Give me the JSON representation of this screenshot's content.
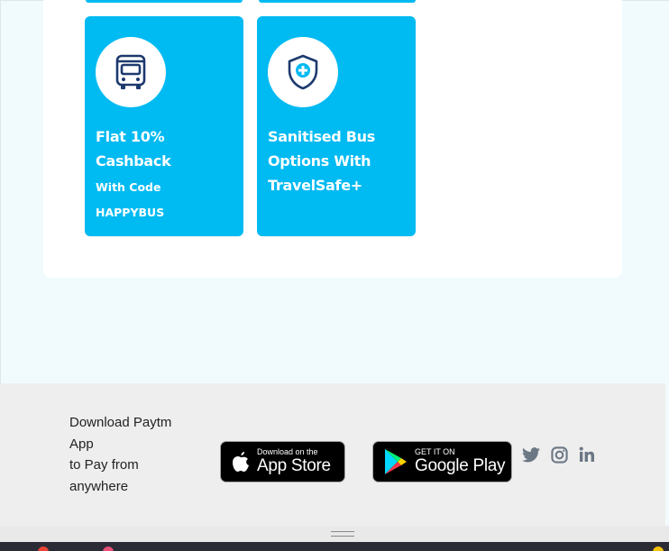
{
  "offers": [
    {
      "icon": "bus-icon",
      "title": "Flat 10% Cashback",
      "title_line1": "Flat 10%",
      "title_line2": "Cashback",
      "subtitle_line1": "With Code",
      "subtitle_line2": "HAPPYBUS"
    },
    {
      "icon": "shield-plus-icon",
      "title_line1": "Sanitised Bus",
      "title_line2": "Options With",
      "title_line3": "TravelSafe+"
    }
  ],
  "footer": {
    "download_line1": "Download Paytm",
    "download_line2": "App",
    "download_line3": "to Pay from",
    "download_line4": "anywhere",
    "app_store": {
      "small": "Download on the",
      "big": "App Store"
    },
    "google_play": {
      "small": "GET IT ON",
      "big": "Google Play"
    },
    "social": [
      "twitter-icon",
      "instagram-icon",
      "linkedin-icon"
    ]
  },
  "colors": {
    "card_bg": "#00baf2",
    "icon_navy": "#1d3a6e",
    "footer_bg": "#eeeeee"
  }
}
